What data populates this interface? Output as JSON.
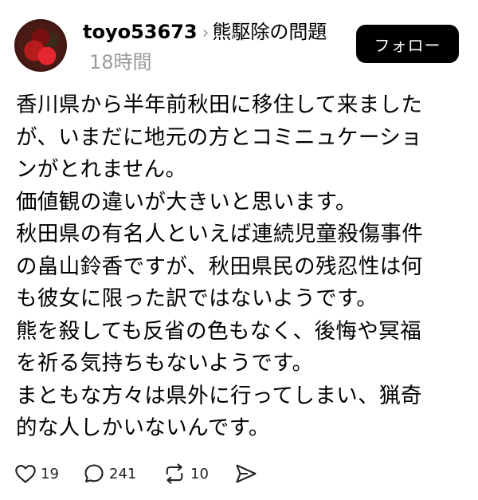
{
  "post": {
    "username": "toyo53673",
    "topic": "熊駆除の問題",
    "time": "18時間",
    "follow_label": "フォロー",
    "lines": [
      "香川県から半年前秋田に移住して来ました",
      "が、いまだに地元の方とコミニュケーショ",
      "ンがとれません。",
      "価値観の違いが大きいと思います。",
      "秋田県の有名人といえば連続児童殺傷事件",
      "の畠山鈴香ですが、秋田県民の残忍性は何",
      "も彼女に限った訳ではないようです。",
      "熊を殺しても反省の色もなく、後悔や冥福",
      "を祈る気持ちもないようです。",
      "まともな方々は県外に行ってしまい、猟奇",
      "的な人しかいないんです。"
    ]
  },
  "actions": {
    "like": {
      "icon": "heart-icon",
      "count": "19"
    },
    "reply": {
      "icon": "comment-icon",
      "count": "241"
    },
    "repost": {
      "icon": "repost-icon",
      "count": "10"
    },
    "share": {
      "icon": "send-icon"
    }
  }
}
